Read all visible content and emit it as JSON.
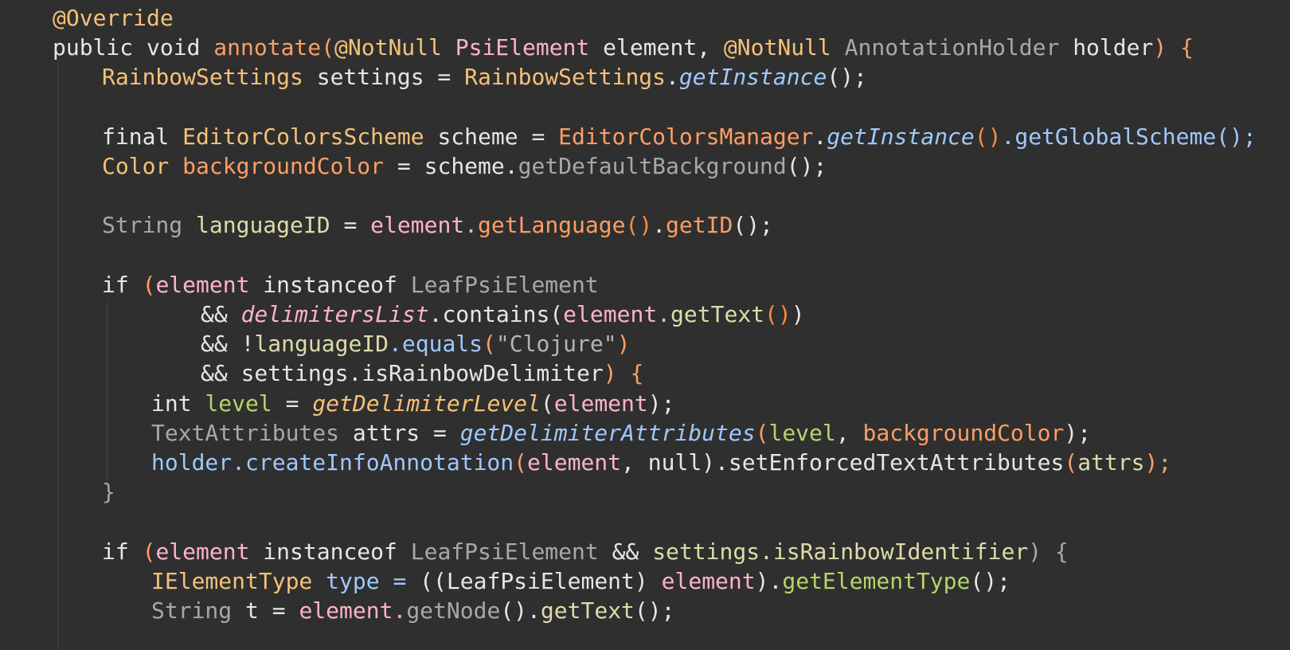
{
  "colors": {
    "background": "#2f2f2f",
    "indent_guide": "#444444",
    "plain": "#e6e6e6",
    "keyword": "#dcdcaa",
    "type": "#f6c177",
    "orange": "#ff9e64",
    "method": "#9fc8ff",
    "string": "#b5b5b5",
    "green": "#b5d56a",
    "gray": "#a8a8a8",
    "pink": "#ffb3c6",
    "paren_orange": "#ff8c42"
  },
  "lines": [
    {
      "indent": 0,
      "tokens": [
        {
          "text": "@Override",
          "color": "#f6c177"
        }
      ]
    },
    {
      "indent": 0,
      "tokens": [
        {
          "text": "public void ",
          "color": "#e6e6e6"
        },
        {
          "text": "annotate",
          "color": "#ff9e64"
        },
        {
          "text": "(",
          "color": "#ff9e64"
        },
        {
          "text": "@NotNull ",
          "color": "#f6c177"
        },
        {
          "text": "PsiElement ",
          "color": "#ffb3c6"
        },
        {
          "text": "element",
          "color": "#e6e6e6"
        },
        {
          "text": ", ",
          "color": "#e6e6e6"
        },
        {
          "text": "@NotNull ",
          "color": "#f6c177"
        },
        {
          "text": "AnnotationHolder ",
          "color": "#a8a8a8"
        },
        {
          "text": "holder",
          "color": "#e6e6e6"
        },
        {
          "text": ") {",
          "color": "#ff9e64"
        }
      ]
    },
    {
      "indent": 1,
      "tokens": [
        {
          "text": "RainbowSettings ",
          "color": "#f6c177"
        },
        {
          "text": "settings = ",
          "color": "#e6e6e6"
        },
        {
          "text": "RainbowSettings",
          "color": "#f6c177"
        },
        {
          "text": ".",
          "color": "#e6e6e6"
        },
        {
          "text": "getInstance",
          "color": "#9fc8ff",
          "italic": true
        },
        {
          "text": "();",
          "color": "#e6e6e6"
        }
      ]
    },
    {
      "indent": 1,
      "tokens": []
    },
    {
      "indent": 1,
      "tokens": [
        {
          "text": "final ",
          "color": "#e6e6e6"
        },
        {
          "text": "EditorColorsScheme ",
          "color": "#f6c177"
        },
        {
          "text": "scheme = ",
          "color": "#e6e6e6"
        },
        {
          "text": "EditorColorsManager",
          "color": "#ff9e64"
        },
        {
          "text": ".",
          "color": "#e6e6e6"
        },
        {
          "text": "getInstance",
          "color": "#9fc8ff",
          "italic": true
        },
        {
          "text": "()",
          "color": "#ff8c42"
        },
        {
          "text": ".getGlobalScheme();",
          "color": "#9fc8ff"
        }
      ]
    },
    {
      "indent": 1,
      "tokens": [
        {
          "text": "Color ",
          "color": "#f6c177"
        },
        {
          "text": "backgroundColor",
          "color": "#ff9e64"
        },
        {
          "text": " = scheme.",
          "color": "#e6e6e6"
        },
        {
          "text": "getDefaultBackground",
          "color": "#a8a8a8"
        },
        {
          "text": "();",
          "color": "#e6e6e6"
        }
      ]
    },
    {
      "indent": 1,
      "tokens": []
    },
    {
      "indent": 1,
      "tokens": [
        {
          "text": "String ",
          "color": "#a8a8a8"
        },
        {
          "text": "languageID",
          "color": "#dcdcaa"
        },
        {
          "text": " = ",
          "color": "#e6e6e6"
        },
        {
          "text": "element.",
          "color": "#ffb3c6"
        },
        {
          "text": "getLanguage",
          "color": "#ff9e64"
        },
        {
          "text": "()",
          "color": "#ff8c42"
        },
        {
          "text": ".",
          "color": "#e6e6e6"
        },
        {
          "text": "getID",
          "color": "#ff9e64"
        },
        {
          "text": "();",
          "color": "#e6e6e6"
        }
      ]
    },
    {
      "indent": 1,
      "tokens": []
    },
    {
      "indent": 1,
      "tokens": [
        {
          "text": "if ",
          "color": "#e6e6e6"
        },
        {
          "text": "(",
          "color": "#ff9e64"
        },
        {
          "text": "element ",
          "color": "#ffb3c6"
        },
        {
          "text": "instanceof ",
          "color": "#e6e6e6"
        },
        {
          "text": "LeafPsiElement",
          "color": "#a8a8a8"
        }
      ]
    },
    {
      "indent": 3,
      "tokens": [
        {
          "text": "&& ",
          "color": "#e6e6e6"
        },
        {
          "text": "delimitersList",
          "color": "#ffb3c6",
          "italic": true
        },
        {
          "text": ".contains(",
          "color": "#e6e6e6"
        },
        {
          "text": "element.",
          "color": "#ffb3c6"
        },
        {
          "text": "getText",
          "color": "#dcdcaa"
        },
        {
          "text": "()",
          "color": "#ff8c42"
        },
        {
          "text": ")",
          "color": "#e6e6e6"
        }
      ]
    },
    {
      "indent": 3,
      "tokens": [
        {
          "text": "&& !",
          "color": "#e6e6e6"
        },
        {
          "text": "languageID",
          "color": "#dcdcaa"
        },
        {
          "text": ".equals",
          "color": "#9fc8ff"
        },
        {
          "text": "(",
          "color": "#ff9e64"
        },
        {
          "text": "\"Clojure\"",
          "color": "#b5b5b5"
        },
        {
          "text": ")",
          "color": "#ff9e64"
        }
      ]
    },
    {
      "indent": 3,
      "tokens": [
        {
          "text": "&& settings.isRainbowDelimiter",
          "color": "#e6e6e6"
        },
        {
          "text": ") {",
          "color": "#ff9e64"
        }
      ]
    },
    {
      "indent": 2,
      "tokens": [
        {
          "text": "int ",
          "color": "#e6e6e6"
        },
        {
          "text": "level",
          "color": "#b5d56a"
        },
        {
          "text": " = ",
          "color": "#e6e6e6"
        },
        {
          "text": "getDelimiterLevel",
          "color": "#f6c177",
          "italic": true
        },
        {
          "text": "(",
          "color": "#e6e6e6"
        },
        {
          "text": "element",
          "color": "#ffb3c6"
        },
        {
          "text": ");",
          "color": "#e6e6e6"
        }
      ]
    },
    {
      "indent": 2,
      "tokens": [
        {
          "text": "TextAttributes ",
          "color": "#a8a8a8"
        },
        {
          "text": "attrs = ",
          "color": "#e6e6e6"
        },
        {
          "text": "getDelimiterAttributes",
          "color": "#9fc8ff",
          "italic": true
        },
        {
          "text": "(",
          "color": "#ff9e64"
        },
        {
          "text": "level",
          "color": "#b5d56a"
        },
        {
          "text": ", ",
          "color": "#e6e6e6"
        },
        {
          "text": "backgroundColor",
          "color": "#ff9e64"
        },
        {
          "text": ");",
          "color": "#e6e6e6"
        }
      ]
    },
    {
      "indent": 2,
      "tokens": [
        {
          "text": "holder.createInfoAnnotation",
          "color": "#9fc8ff"
        },
        {
          "text": "(",
          "color": "#ff9e64"
        },
        {
          "text": "element",
          "color": "#ffb3c6"
        },
        {
          "text": ", null).setEnforcedTextAttributes",
          "color": "#e6e6e6"
        },
        {
          "text": "(",
          "color": "#ff9e64"
        },
        {
          "text": "attrs",
          "color": "#dcdcaa"
        },
        {
          "text": ");",
          "color": "#ff9e64"
        }
      ]
    },
    {
      "indent": 1,
      "tokens": [
        {
          "text": "}",
          "color": "#a8a8a8"
        }
      ]
    },
    {
      "indent": 1,
      "tokens": []
    },
    {
      "indent": 1,
      "tokens": [
        {
          "text": "if ",
          "color": "#e6e6e6"
        },
        {
          "text": "(",
          "color": "#ff9e64"
        },
        {
          "text": "element ",
          "color": "#ffb3c6"
        },
        {
          "text": "instanceof ",
          "color": "#e6e6e6"
        },
        {
          "text": "LeafPsiElement ",
          "color": "#a8a8a8"
        },
        {
          "text": "&& ",
          "color": "#e6e6e6"
        },
        {
          "text": "settings.isRainbowIdentifier",
          "color": "#dcdcaa"
        },
        {
          "text": ") {",
          "color": "#a8a8a8"
        }
      ]
    },
    {
      "indent": 2,
      "tokens": [
        {
          "text": "IElementType ",
          "color": "#f6c177"
        },
        {
          "text": "type = ",
          "color": "#9fc8ff"
        },
        {
          "text": "((",
          "color": "#e6e6e6"
        },
        {
          "text": "LeafPsiElement",
          "color": "#e6e6e6"
        },
        {
          "text": ") ",
          "color": "#e6e6e6"
        },
        {
          "text": "element",
          "color": "#ffb3c6"
        },
        {
          "text": ").",
          "color": "#e6e6e6"
        },
        {
          "text": "getElementType",
          "color": "#b5d56a"
        },
        {
          "text": "();",
          "color": "#e6e6e6"
        }
      ]
    },
    {
      "indent": 2,
      "tokens": [
        {
          "text": "String ",
          "color": "#a8a8a8"
        },
        {
          "text": "t = ",
          "color": "#e6e6e6"
        },
        {
          "text": "element.",
          "color": "#ffb3c6"
        },
        {
          "text": "getNode",
          "color": "#a8a8a8"
        },
        {
          "text": "().",
          "color": "#e6e6e6"
        },
        {
          "text": "getText",
          "color": "#dcdcaa"
        },
        {
          "text": "();",
          "color": "#e6e6e6"
        }
      ]
    }
  ]
}
